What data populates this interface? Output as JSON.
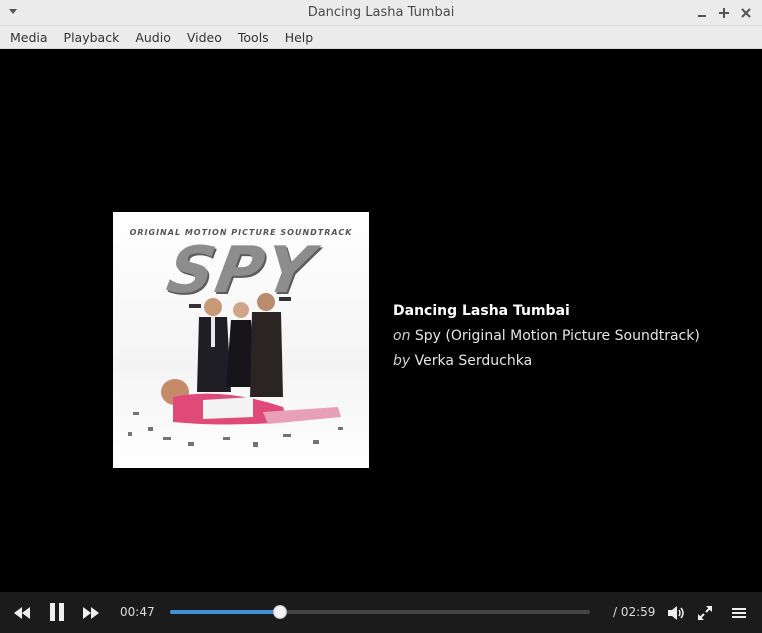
{
  "window": {
    "title": "Dancing Lasha Tumbai"
  },
  "menu": {
    "items": [
      "Media",
      "Playback",
      "Audio",
      "Video",
      "Tools",
      "Help"
    ]
  },
  "cover": {
    "top_text": "ORIGINAL MOTION PICTURE SOUNDTRACK",
    "logo_text": "SPY"
  },
  "track": {
    "title": "Dancing Lasha Tumbai",
    "album_prefix": "on",
    "album": "Spy (Original Motion Picture Soundtrack)",
    "artist_prefix": "by",
    "artist": "Verka Serduchka"
  },
  "playback": {
    "elapsed": "00:47",
    "total": "/ 02:59",
    "progress_fraction": 0.262,
    "state": "playing"
  },
  "colors": {
    "accent": "#3d8fd8",
    "controls_bg": "#1b1b1b",
    "chrome_bg": "#ebebeb"
  },
  "icons": {
    "window_menu": "chevron-down-icon",
    "minimize": "minimize-icon",
    "maximize": "maximize-icon",
    "close": "close-icon",
    "prev": "skip-back-icon",
    "pause": "pause-icon",
    "next": "skip-forward-icon",
    "volume": "volume-icon",
    "fullscreen": "fullscreen-icon",
    "playlist": "playlist-icon"
  }
}
